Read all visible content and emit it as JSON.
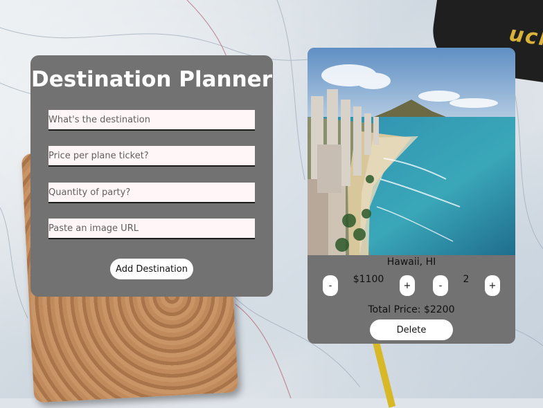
{
  "planner": {
    "title": "Destination Planner",
    "destination_placeholder": "What's the destination",
    "price_placeholder": "Price per plane ticket?",
    "quantity_placeholder": "Quantity of party?",
    "image_placeholder": "Paste an image URL",
    "add_button_label": "Add Destination"
  },
  "card": {
    "name": "Hawaii, HI",
    "price": "$1100",
    "quantity": "2",
    "decrement_label": "-",
    "increment_label": "+",
    "total": "Total Price: $2200",
    "delete_label": "Delete"
  },
  "colors": {
    "panel": "#727272",
    "field": "#fff7f7",
    "button": "#ffffff"
  }
}
